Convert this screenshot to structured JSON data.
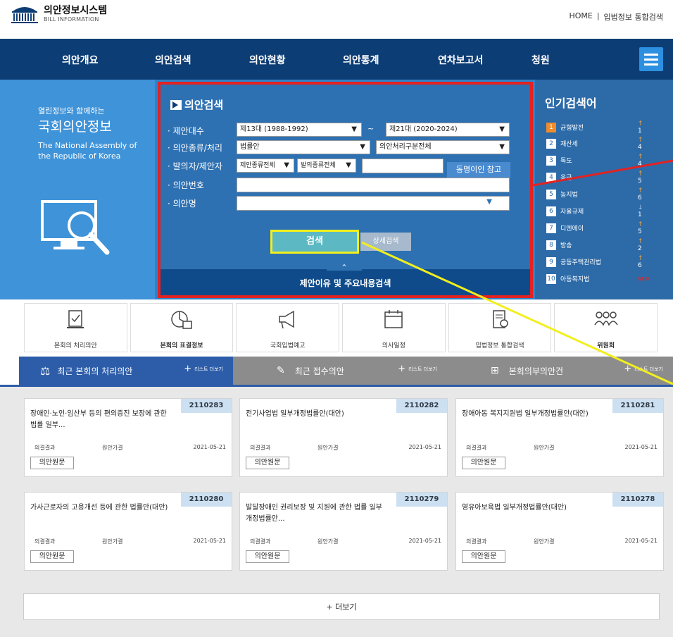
{
  "header": {
    "logo_title": "의안정보시스템",
    "logo_sub": "BILL INFORMATION",
    "links": [
      "HOME",
      "입법정보 통합검색"
    ],
    "link_sep": "|"
  },
  "nav": {
    "items": [
      "의안개요",
      "의안검색",
      "의안현황",
      "의안통계",
      "연차보고서",
      "청원"
    ]
  },
  "hero": {
    "line1": "열린정보와 함께하는",
    "line2": "국회의안정보",
    "line3": "The National Assembly of the Republic of Korea"
  },
  "search": {
    "title": "의안검색",
    "row1_label": "· 제안대수",
    "row1_from": "제13대 (1988-1992)",
    "row1_to": "제21대 (2020-2024)",
    "tilde": "~",
    "row2_label": "· 의안종류/처리",
    "row2_kind": "법률안",
    "row2_proc": "의안처리구분전체",
    "row3_label": "· 발의자/제안자",
    "row3_a": "제안종류전체",
    "row3_b": "발의종류전체",
    "row3_btn": "동명이인 참고",
    "row4_label": "· 의안번호",
    "row5_label": "· 의안명",
    "search_btn": "검색",
    "detail_btn": "상세검색",
    "bottom": "제안이유 및 주요내용검색",
    "bottom_tab": "^"
  },
  "popular": {
    "title": "인기검색어",
    "items": [
      {
        "n": "1",
        "label": "균형발전",
        "trend": "1",
        "dir": "up"
      },
      {
        "n": "2",
        "label": "재산세",
        "trend": "4",
        "dir": "up"
      },
      {
        "n": "3",
        "label": "독도",
        "trend": "4",
        "dir": "up"
      },
      {
        "n": "4",
        "label": "응급",
        "trend": "5",
        "dir": "up"
      },
      {
        "n": "5",
        "label": "농지법",
        "trend": "6",
        "dir": "up"
      },
      {
        "n": "6",
        "label": "자율규제",
        "trend": "1",
        "dir": "down"
      },
      {
        "n": "7",
        "label": "디엔에이",
        "trend": "5",
        "dir": "up"
      },
      {
        "n": "8",
        "label": "방송",
        "trend": "2",
        "dir": "up"
      },
      {
        "n": "9",
        "label": "공동주택관리법",
        "trend": "6",
        "dir": "up"
      },
      {
        "n": "10",
        "label": "아동복지법",
        "trend": "NEW",
        "dir": "new"
      }
    ]
  },
  "quick": {
    "items": [
      "본회의 처리의안",
      "본회의 표결정보",
      "국회입법예고",
      "의사일정",
      "입법정보 통합검색",
      "위원회"
    ]
  },
  "tabs": {
    "items": [
      "최근 본회의 처리의안",
      "최근 접수의안",
      "본회의부의안건"
    ],
    "more": "리스트 더보기"
  },
  "cards": [
    {
      "num": "2110283",
      "title": "장애인·노인·임산부 등의 편의증진 보장에 관한 법률 일부...",
      "k": "의결결과",
      "v": "원안가결",
      "date": "2021-05-21",
      "btn": "의안원문"
    },
    {
      "num": "2110282",
      "title": "전기사업법 일부개정법률안(대안)",
      "k": "의결결과",
      "v": "원안가결",
      "date": "2021-05-21",
      "btn": "의안원문"
    },
    {
      "num": "2110281",
      "title": "장애아동 복지지원법 일부개정법률안(대안)",
      "k": "의결결과",
      "v": "원안가결",
      "date": "2021-05-21",
      "btn": "의안원문"
    },
    {
      "num": "2110280",
      "title": "가사근로자의 고용개선 등에 관한 법률안(대안)",
      "k": "의결결과",
      "v": "원안가결",
      "date": "2021-05-21",
      "btn": "의안원문"
    },
    {
      "num": "2110279",
      "title": "발달장애인 권리보장 및 지원에 관한 법률 일부개정법률안...",
      "k": "의결결과",
      "v": "원안가결",
      "date": "2021-05-21",
      "btn": "의안원문"
    },
    {
      "num": "2110278",
      "title": "영유아보육법 일부개정법률안(대안)",
      "k": "의결결과",
      "v": "원안가결",
      "date": "2021-05-21",
      "btn": "의안원문"
    }
  ],
  "more_btn": "+ 더보기",
  "colors": {
    "nav": "#0d3d75",
    "hero": "#2f82c9",
    "highlight_red": "#e32222",
    "highlight_yellow": "#f2ef1e"
  }
}
